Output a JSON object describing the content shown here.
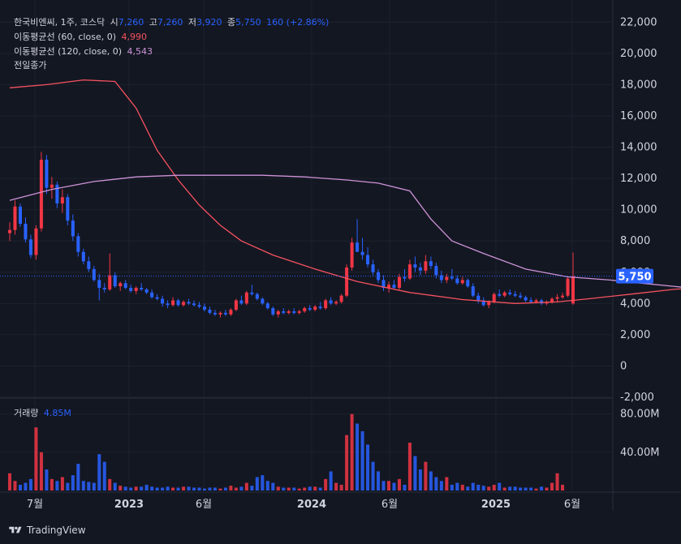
{
  "header": {
    "symbol": "한국비엔씨, 1주, 코스닥",
    "open_label": "시",
    "open": "7,260",
    "high_label": "고",
    "high": "7,260",
    "low_label": "저",
    "low": "3,920",
    "close_label": "종",
    "close": "5,750",
    "change": "160 (+2.86%)"
  },
  "indicators": [
    {
      "label": "이동평균선 (60, close, 0)",
      "value": "4,990",
      "color": "#f7525f"
    },
    {
      "label": "이동평균선 (120, close, 0)",
      "value": "4,543",
      "color": "#ce93d8"
    },
    {
      "label": "전일종가",
      "value": "",
      "color": "#d1d4dc"
    }
  ],
  "volume_panel": {
    "label": "거래량",
    "value": "4.85M"
  },
  "price_badge": "5,750",
  "brand": "TradingView",
  "colors": {
    "up": "#f23645",
    "down": "#2962ff",
    "ma60": "#f7525f",
    "ma120": "#ce93d8",
    "background": "#131722",
    "grid": "#1e222d",
    "text": "#d1d4dc"
  },
  "chart_data": [
    {
      "type": "candlestick",
      "interval": "1 week",
      "price_axis": {
        "ticks": [
          "22,000",
          "20,000",
          "18,000",
          "16,000",
          "14,000",
          "12,000",
          "10,000",
          "8,000",
          "6,000",
          "4,000",
          "2,000",
          "0",
          "-2,000"
        ],
        "range": [
          -2000,
          23000
        ]
      },
      "time_axis": {
        "ticks": [
          "7월",
          "2023",
          "6월",
          "2024",
          "6월",
          "2025",
          "6월"
        ]
      },
      "last_price": 5750,
      "grid": true,
      "series": [
        {
          "name": "이동평균선 (60, close, 0)",
          "color": "#f7525f",
          "x": [
            0,
            7,
            14,
            20,
            24,
            28,
            32,
            36,
            40,
            44,
            50,
            58,
            66,
            76,
            86,
            96,
            104,
            110,
            118,
            126,
            134,
            140,
            146,
            152
          ],
          "values": [
            17800,
            18000,
            18300,
            18200,
            16500,
            13800,
            11900,
            10300,
            9000,
            8000,
            7100,
            6200,
            5400,
            4700,
            4250,
            4000,
            4100,
            4300,
            4600,
            4900,
            5100,
            5200,
            5300,
            4990
          ]
        },
        {
          "name": "이동평均線 (120, close, 0)",
          "color": "#ce93d8",
          "x": [
            0,
            8,
            16,
            24,
            32,
            40,
            48,
            56,
            64,
            70,
            76,
            80,
            84,
            90,
            98,
            106,
            114,
            120,
            126,
            132,
            138,
            144,
            152
          ],
          "values": [
            10600,
            11300,
            11800,
            12100,
            12200,
            12200,
            12200,
            12100,
            11900,
            11700,
            11200,
            9400,
            8000,
            7200,
            6200,
            5700,
            5500,
            5300,
            5100,
            4900,
            4750,
            4650,
            4543
          ]
        }
      ],
      "candles": [
        [
          8500,
          9200,
          8000,
          8700
        ],
        [
          8700,
          10600,
          8400,
          10200
        ],
        [
          10200,
          10400,
          8900,
          9100
        ],
        [
          9100,
          9500,
          7900,
          8100
        ],
        [
          8100,
          8400,
          6900,
          7100
        ],
        [
          7100,
          9000,
          6800,
          8800
        ],
        [
          8800,
          13700,
          8600,
          13200
        ],
        [
          13200,
          13500,
          11000,
          11400
        ],
        [
          11400,
          12100,
          10700,
          11600
        ],
        [
          11600,
          11800,
          10100,
          10400
        ],
        [
          10400,
          11300,
          9800,
          10800
        ],
        [
          10800,
          11000,
          9000,
          9300
        ],
        [
          9300,
          9700,
          8000,
          8300
        ],
        [
          8300,
          8500,
          7000,
          7300
        ],
        [
          7300,
          7500,
          6500,
          6700
        ],
        [
          6700,
          7000,
          6000,
          6200
        ],
        [
          6200,
          6400,
          5400,
          5500
        ],
        [
          5500,
          5900,
          4200,
          5000
        ],
        [
          5000,
          5300,
          4700,
          4900
        ],
        [
          4900,
          7200,
          4800,
          5800
        ],
        [
          5800,
          6000,
          5000,
          5100
        ],
        [
          5100,
          5400,
          4800,
          5300
        ],
        [
          5300,
          5500,
          4900,
          5000
        ],
        [
          5000,
          5200,
          4700,
          4800
        ],
        [
          4800,
          5100,
          4600,
          5000
        ],
        [
          5000,
          5300,
          4800,
          4900
        ],
        [
          4900,
          5000,
          4600,
          4700
        ],
        [
          4700,
          4900,
          4300,
          4400
        ],
        [
          4400,
          4600,
          4200,
          4300
        ],
        [
          4300,
          4500,
          3800,
          4000
        ],
        [
          4000,
          4200,
          3700,
          3900
        ],
        [
          3900,
          4400,
          3800,
          4200
        ],
        [
          4200,
          4300,
          3800,
          3900
        ],
        [
          3900,
          4200,
          3800,
          4100
        ],
        [
          4100,
          4300,
          3900,
          4000
        ],
        [
          4000,
          4200,
          3800,
          3900
        ],
        [
          3900,
          4100,
          3700,
          3800
        ],
        [
          3800,
          4000,
          3500,
          3600
        ],
        [
          3600,
          3800,
          3300,
          3400
        ],
        [
          3400,
          3600,
          3200,
          3300
        ],
        [
          3300,
          3500,
          3100,
          3400
        ],
        [
          3400,
          3600,
          3200,
          3300
        ],
        [
          3300,
          3700,
          3200,
          3600
        ],
        [
          3600,
          4300,
          3500,
          4200
        ],
        [
          4200,
          4500,
          3900,
          4000
        ],
        [
          4000,
          4800,
          3900,
          4700
        ],
        [
          4700,
          5200,
          4500,
          4600
        ],
        [
          4600,
          4700,
          4200,
          4300
        ],
        [
          4300,
          4400,
          3900,
          4000
        ],
        [
          4000,
          4100,
          3600,
          3700
        ],
        [
          3700,
          3800,
          3200,
          3300
        ],
        [
          3300,
          3600,
          3100,
          3500
        ],
        [
          3500,
          3700,
          3300,
          3400
        ],
        [
          3400,
          3600,
          3300,
          3500
        ],
        [
          3500,
          3700,
          3300,
          3400
        ],
        [
          3400,
          3600,
          3300,
          3500
        ],
        [
          3500,
          3800,
          3400,
          3700
        ],
        [
          3700,
          3900,
          3500,
          3600
        ],
        [
          3600,
          3900,
          3500,
          3800
        ],
        [
          3800,
          4100,
          3600,
          3700
        ],
        [
          3700,
          4300,
          3600,
          4200
        ],
        [
          4200,
          4400,
          3900,
          4000
        ],
        [
          4000,
          4200,
          3900,
          4100
        ],
        [
          4100,
          4600,
          4000,
          4500
        ],
        [
          4500,
          6500,
          4400,
          6300
        ],
        [
          6300,
          8200,
          6100,
          7900
        ],
        [
          7900,
          9400,
          7600,
          7300
        ],
        [
          7300,
          8200,
          6800,
          7100
        ],
        [
          7100,
          7600,
          6300,
          6500
        ],
        [
          6500,
          6800,
          5800,
          6000
        ],
        [
          6000,
          6200,
          5300,
          5500
        ],
        [
          5500,
          5800,
          4800,
          5000
        ],
        [
          5000,
          5400,
          4700,
          5200
        ],
        [
          5200,
          5500,
          4900,
          5000
        ],
        [
          5000,
          5900,
          4900,
          5700
        ],
        [
          5700,
          6200,
          5400,
          5600
        ],
        [
          5600,
          6800,
          5500,
          6500
        ],
        [
          6500,
          7000,
          6000,
          6300
        ],
        [
          6300,
          6600,
          5800,
          6100
        ],
        [
          6100,
          7100,
          5900,
          6700
        ],
        [
          6700,
          7000,
          6200,
          6400
        ],
        [
          6400,
          6600,
          5600,
          5800
        ],
        [
          5800,
          6100,
          5300,
          5500
        ],
        [
          5500,
          5900,
          5300,
          5700
        ],
        [
          5700,
          6200,
          5500,
          5600
        ],
        [
          5600,
          5800,
          5200,
          5300
        ],
        [
          5300,
          5700,
          5200,
          5500
        ],
        [
          5500,
          5600,
          5000,
          5100
        ],
        [
          5100,
          5300,
          4400,
          4500
        ],
        [
          4500,
          4700,
          4000,
          4200
        ],
        [
          4200,
          4400,
          3800,
          3900
        ],
        [
          3900,
          4200,
          3700,
          4100
        ],
        [
          4100,
          4700,
          4000,
          4600
        ],
        [
          4600,
          4900,
          4400,
          4500
        ],
        [
          4500,
          4800,
          4400,
          4700
        ],
        [
          4700,
          4900,
          4500,
          4600
        ],
        [
          4600,
          4800,
          4400,
          4500
        ],
        [
          4500,
          4700,
          4300,
          4400
        ],
        [
          4400,
          4500,
          4100,
          4200
        ],
        [
          4200,
          4400,
          4000,
          4100
        ],
        [
          4100,
          4300,
          4000,
          4200
        ],
        [
          4200,
          4300,
          3900,
          4000
        ],
        [
          4000,
          4200,
          3900,
          4100
        ],
        [
          4100,
          4400,
          4000,
          4300
        ],
        [
          4300,
          4600,
          4100,
          4400
        ],
        [
          4400,
          4700,
          4300,
          4500
        ],
        [
          4500,
          5700,
          4400,
          5590
        ],
        [
          4000,
          7260,
          3920,
          5750
        ]
      ],
      "volume_axis": {
        "ticks": [
          "80.00M",
          "40.00M"
        ],
        "range": [
          0,
          95
        ]
      },
      "volume_unit": "M",
      "volume": [
        18,
        10,
        6,
        8,
        12,
        66,
        40,
        22,
        12,
        10,
        14,
        8,
        16,
        28,
        10,
        9,
        8,
        38,
        30,
        12,
        8,
        5,
        4,
        3,
        4,
        4,
        6,
        4,
        3,
        3,
        4,
        3,
        3,
        4,
        4,
        3,
        3,
        2,
        3,
        3,
        2,
        3,
        5,
        3,
        4,
        8,
        5,
        14,
        16,
        10,
        8,
        4,
        3,
        3,
        3,
        2,
        3,
        4,
        4,
        3,
        12,
        20,
        8,
        6,
        58,
        80,
        70,
        62,
        48,
        30,
        20,
        10,
        10,
        8,
        12,
        6,
        50,
        36,
        22,
        30,
        20,
        14,
        10,
        14,
        6,
        8,
        6,
        4,
        8,
        6,
        5,
        4,
        6,
        8,
        3,
        4,
        4,
        3,
        3,
        3,
        2,
        4,
        3,
        8,
        18,
        6
      ]
    }
  ]
}
